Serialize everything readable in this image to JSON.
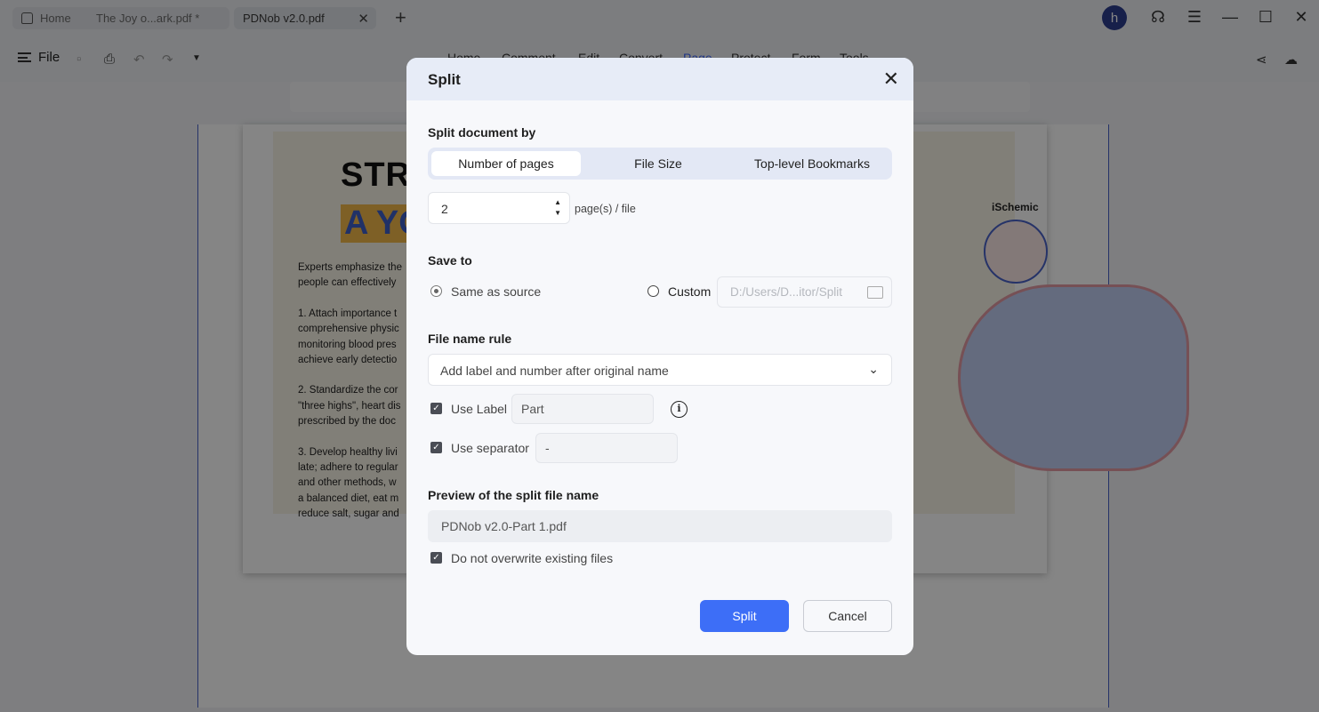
{
  "tabs": {
    "home": "Home",
    "doc1": "The Joy o...ark.pdf *",
    "doc2": "PDNob v2.0.pdf"
  },
  "user": {
    "avatar_letter": "h"
  },
  "toolbar": {
    "file_label": "File",
    "menus": [
      "Home",
      "Comment",
      "Edit",
      "Convert",
      "Page",
      "Protect",
      "Form",
      "Tools"
    ],
    "active_menu": "Page"
  },
  "document": {
    "heading1": "STROK",
    "heading2": "A YOU",
    "illustration_label": "iSchemic",
    "lines": [
      "Experts emphasize the",
      "people can effectively",
      "",
      "1. Attach importance t",
      "comprehensive physic",
      "monitoring blood pres",
      "achieve early detectio",
      "",
      "2. Standardize the cor",
      "\"three highs\", heart dis",
      "prescribed by the doc",
      "",
      "3. Develop healthy livi",
      "late; adhere to regular",
      "and other methods, w",
      "a balanced diet, eat m",
      "reduce salt, sugar and"
    ]
  },
  "dialog": {
    "title": "Split",
    "split_by_heading": "Split document by",
    "split_options": [
      "Number of pages",
      "File Size",
      "Top-level Bookmarks"
    ],
    "selected_option": "Number of pages",
    "pages_value": "2",
    "pages_unit": "page(s) / file",
    "save_to_heading": "Save to",
    "same_as_source_label": "Same as source",
    "custom_label": "Custom",
    "custom_path_placeholder": "D:/Users/D...itor/Split",
    "file_name_rule_heading": "File name rule",
    "file_name_rule_value": "Add label and number after original name",
    "use_label_text": "Use Label",
    "label_value": "Part",
    "use_separator_text": "Use separator",
    "separator_value": "-",
    "preview_heading": "Preview of the split file name",
    "preview_value": "PDNob v2.0-Part 1.pdf",
    "no_overwrite_label": "Do not overwrite existing files",
    "split_button": "Split",
    "cancel_button": "Cancel"
  }
}
